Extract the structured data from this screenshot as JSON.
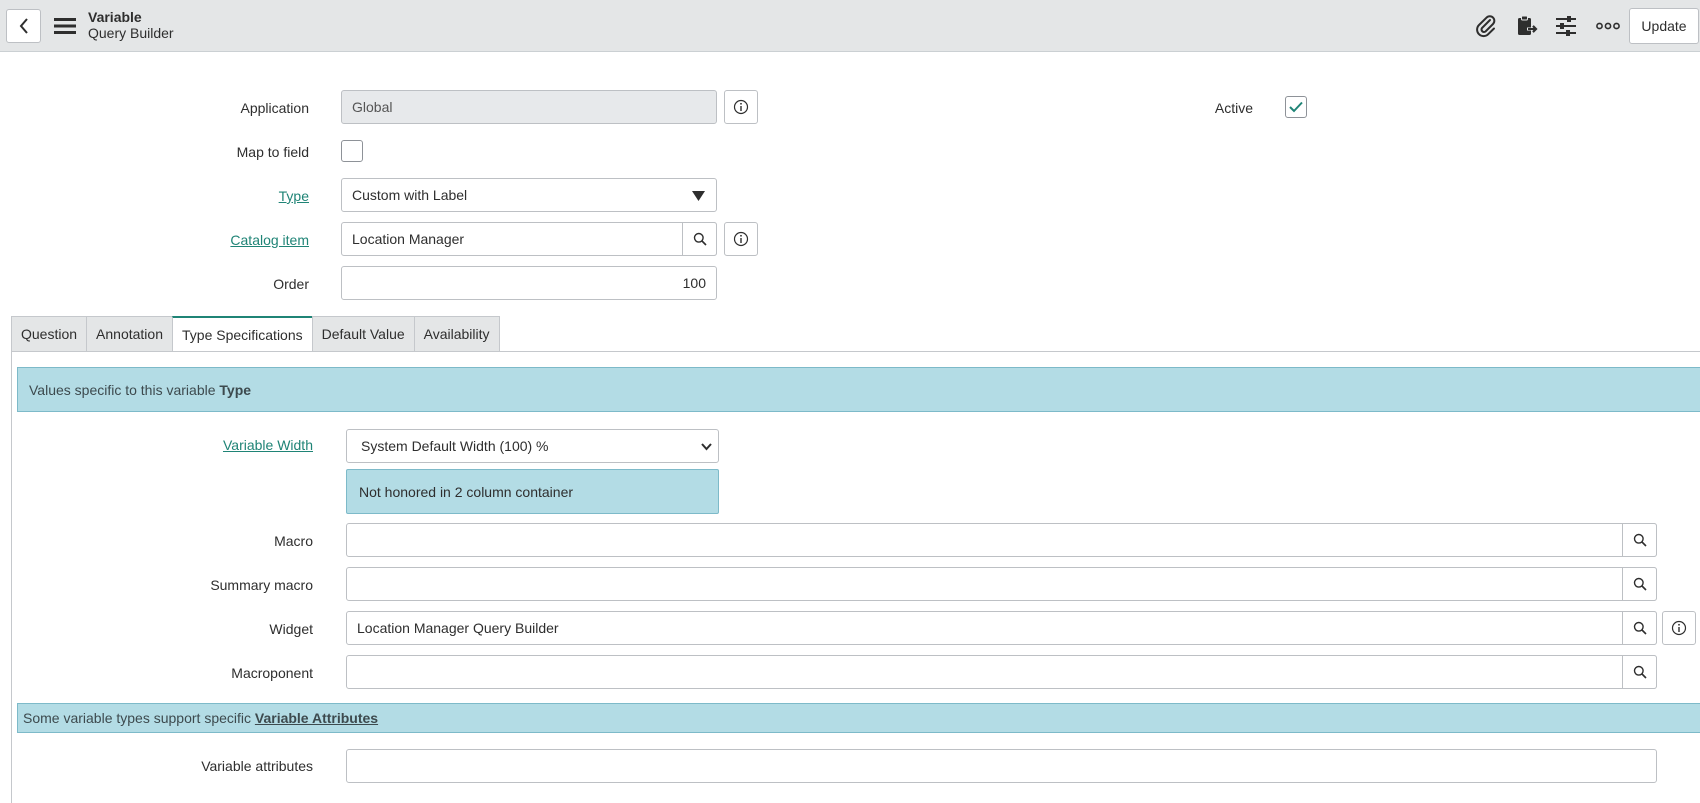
{
  "header": {
    "title": "Variable",
    "subtitle": "Query Builder",
    "update_label": "Update"
  },
  "form": {
    "application": {
      "label": "Application",
      "value": "Global"
    },
    "active": {
      "label": "Active",
      "checked": true
    },
    "map_to_field": {
      "label": "Map to field",
      "checked": false
    },
    "type": {
      "label": "Type",
      "value": "Custom with Label"
    },
    "catalog_item": {
      "label": "Catalog item",
      "value": "Location Manager"
    },
    "order": {
      "label": "Order",
      "value": "100"
    }
  },
  "tabs": [
    {
      "label": "Question"
    },
    {
      "label": "Annotation"
    },
    {
      "label": "Type Specifications"
    },
    {
      "label": "Default Value"
    },
    {
      "label": "Availability"
    }
  ],
  "type_specs": {
    "banner_text": "Values specific to this variable ",
    "banner_bold": "Type",
    "variable_width": {
      "label": "Variable Width",
      "value": "System Default Width (100) %"
    },
    "width_note": "Not honored in 2 column container",
    "macro": {
      "label": "Macro",
      "value": ""
    },
    "summary_macro": {
      "label": "Summary macro",
      "value": ""
    },
    "widget": {
      "label": "Widget",
      "value": "Location Manager Query Builder"
    },
    "macroponent": {
      "label": "Macroponent",
      "value": ""
    },
    "attr_banner_text": "Some variable types support specific ",
    "attr_banner_link": "Variable Attributes",
    "variable_attributes": {
      "label": "Variable attributes",
      "value": ""
    }
  },
  "colors": {
    "accent": "#1f8476",
    "banner": "#b3dce5",
    "header_bg": "#e4e6e7"
  }
}
